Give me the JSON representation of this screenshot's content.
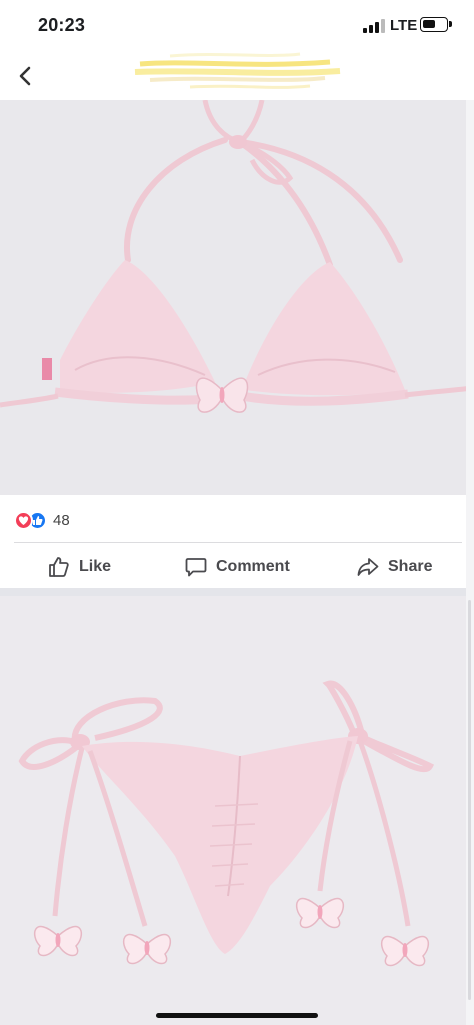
{
  "status_bar": {
    "time": "20:23",
    "network": "LTE",
    "battery_level": 0.55
  },
  "nav": {
    "back_icon": "chevron-left-icon",
    "title_redacted": true
  },
  "post": {
    "reaction_icons": [
      "love-reaction-icon",
      "like-reaction-icon"
    ],
    "reaction_count": "48",
    "actions": {
      "like": "Like",
      "comment": "Comment",
      "share": "Share"
    }
  },
  "colors": {
    "love": "#f33e58",
    "like": "#1877f2",
    "photo_bg": "#e9e8ec",
    "garment_pink": "#f4d4dd",
    "redaction_yellow": "#f7e36a"
  }
}
